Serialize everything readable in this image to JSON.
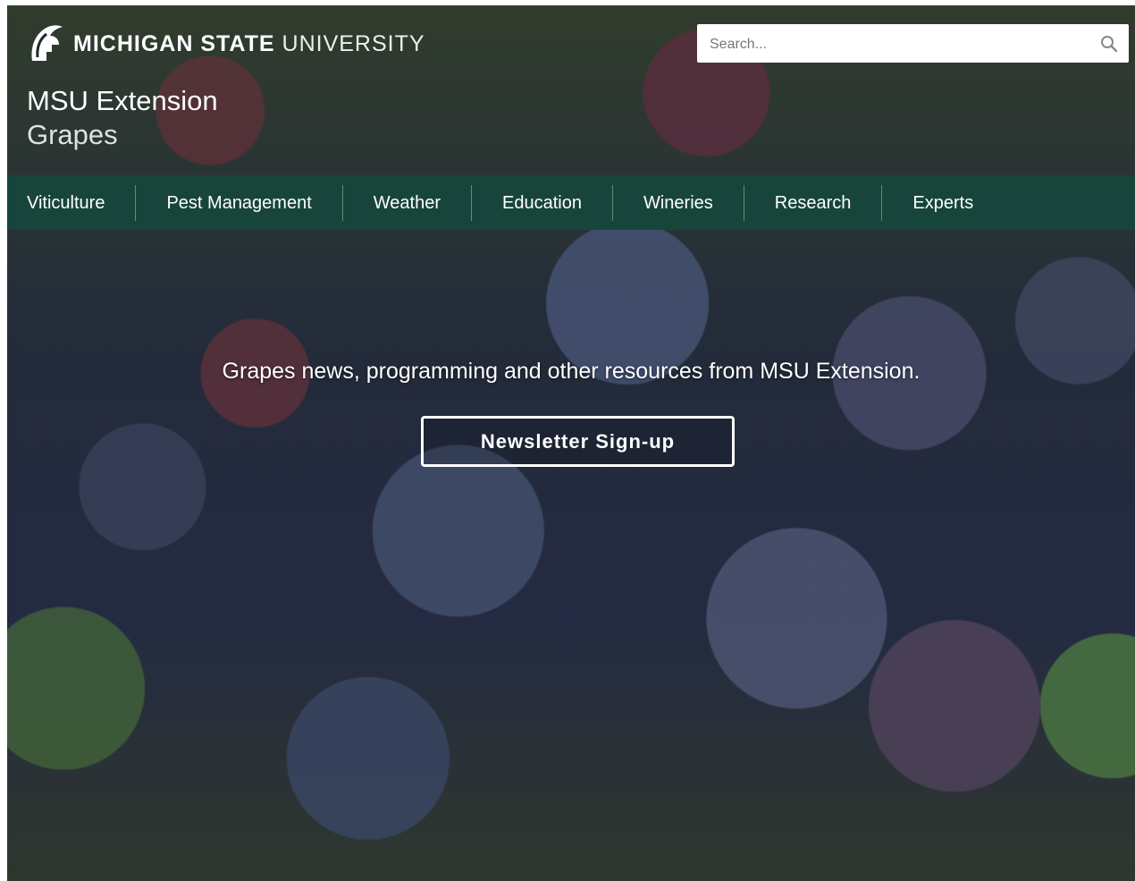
{
  "header": {
    "logo_bold": "MICHIGAN STATE",
    "logo_light": "UNIVERSITY",
    "site_name": "MSU Extension",
    "site_sub": "Grapes"
  },
  "search": {
    "placeholder": "Search...",
    "icon": "search-icon"
  },
  "nav": {
    "items": [
      {
        "label": "Viticulture"
      },
      {
        "label": "Pest Management"
      },
      {
        "label": "Weather"
      },
      {
        "label": "Education"
      },
      {
        "label": "Wineries"
      },
      {
        "label": "Research"
      },
      {
        "label": "Experts"
      }
    ]
  },
  "hero": {
    "tagline": "Grapes news, programming and other resources from MSU Extension.",
    "cta_label": "Newsletter Sign-up"
  },
  "colors": {
    "nav_bg": "#18453b",
    "text": "#ffffff"
  }
}
